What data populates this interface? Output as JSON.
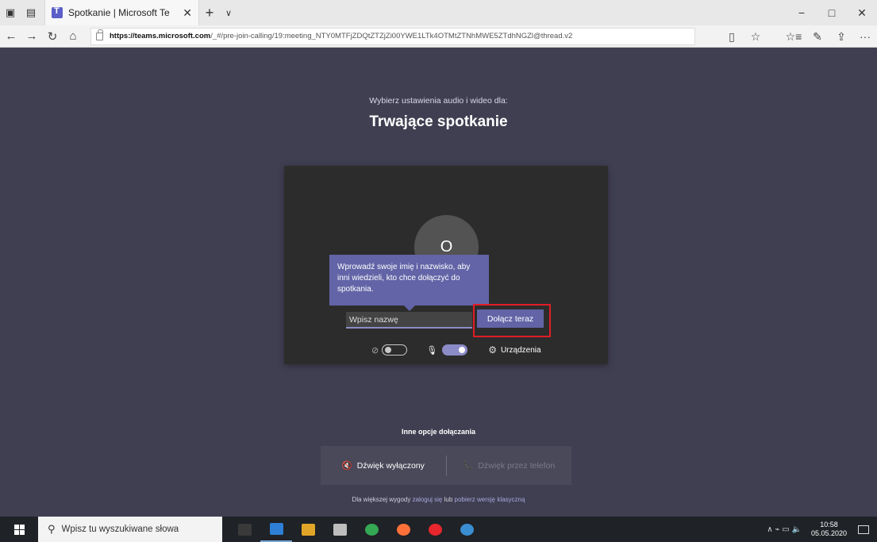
{
  "browser": {
    "tab_title": "Spotkanie | Microsoft Te",
    "tab_close": "✕",
    "new_tab": "+",
    "tab_dropdown": "∨",
    "url_domain": "https://teams.microsoft.com",
    "url_path": "/_#/pre-join-calling/19:meeting_NTY0MTFjZDQtZTZjZi00YWE1LTk4OTMtZTNhMWE5ZTdhNGZl@thread.v2",
    "icons": {
      "back": "←",
      "forward": "→",
      "refresh": "↻",
      "home": "⌂",
      "reading": "▯",
      "favorite": "☆",
      "favorites_bar": "☆≡",
      "notes": "✎",
      "share": "⇪",
      "more": "···",
      "minimize": "−",
      "maximize": "□",
      "close": "✕",
      "tab_aside": "▣",
      "tab_preview": "▤"
    }
  },
  "prejoin": {
    "subtitle": "Wybierz ustawienia audio i wideo dla:",
    "title": "Trwające spotkanie",
    "avatar_glyph": "O",
    "tooltip": "Wprowadź swoje imię i nazwisko, aby inni wiedzieli, kto chce dołączyć do spotkania.",
    "name_placeholder": "Wpisz nazwę",
    "join_label": "Dołącz teraz",
    "camera_icon": "⊘",
    "mic_icon": "🎙",
    "gear_icon": "⚙",
    "devices_label": "Urządzenia",
    "camera_on": false,
    "mic_on": true
  },
  "other_options": {
    "title": "Inne opcje dołączania",
    "audio_off_icon": "🔇",
    "audio_off_label": "Dźwięk wyłączony",
    "phone_icon": "📞",
    "phone_label": "Dźwięk przez telefon",
    "note_prefix": "Dla większej wygody ",
    "note_link1": "zaloguj się",
    "note_middle": " lub ",
    "note_link2": "pobierz wersję klasyczną"
  },
  "taskbar": {
    "search_placeholder": "Wpisz tu wyszukiwane słowa",
    "search_icon": "⚲",
    "tray_icons": "∧ ⌁ ▭ 🔈",
    "time": "10:58",
    "date": "05.05.2020",
    "app_colors": [
      "#3a3a3a",
      "#2e7fd6",
      "#e0a528",
      "#bdbdbd",
      "#34a853",
      "#ff7139",
      "#e8262d",
      "#3a8ed1"
    ]
  }
}
